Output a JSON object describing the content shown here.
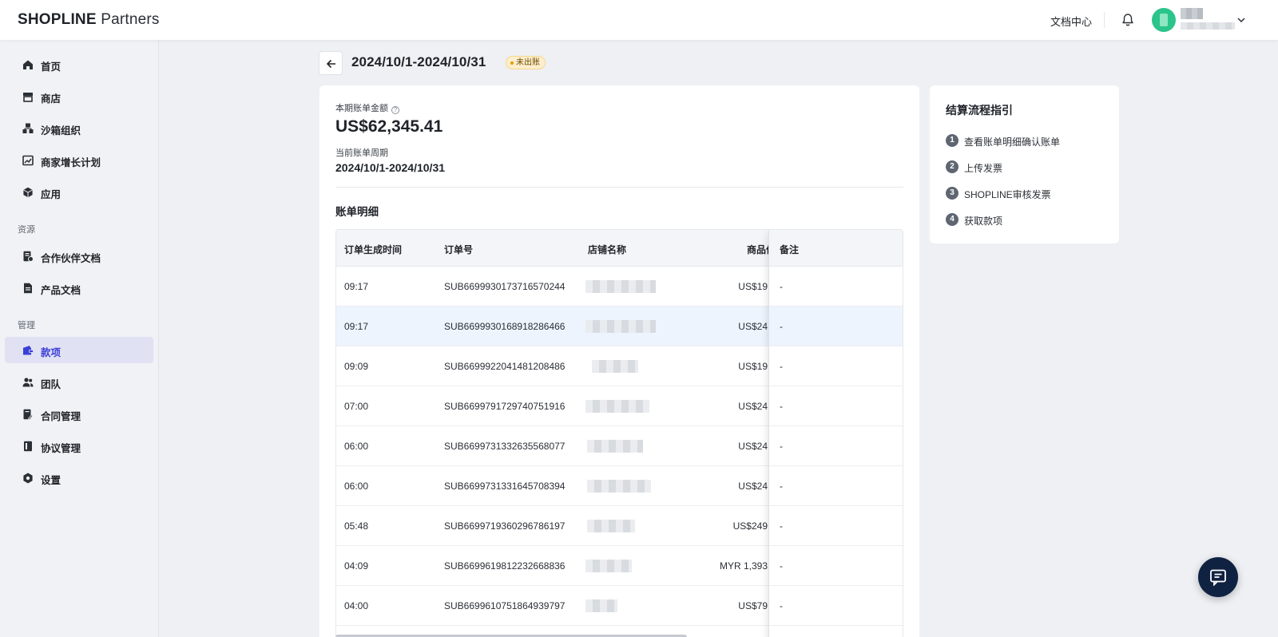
{
  "brand": {
    "logo_bold": "SHOPLINE",
    "logo_rest": "Partners"
  },
  "header": {
    "docs_link": "文档中心"
  },
  "sidebar": {
    "items_main": [
      {
        "label": "首页",
        "icon": "home-icon"
      },
      {
        "label": "商店",
        "icon": "store-icon"
      },
      {
        "label": "沙箱组织",
        "icon": "sandbox-icon"
      },
      {
        "label": "商家增长计划",
        "icon": "growth-chart-icon"
      },
      {
        "label": "应用",
        "icon": "app-cube-icon"
      }
    ],
    "section_resources": "资源",
    "items_resources": [
      {
        "label": "合作伙伴文档",
        "icon": "partner-doc-icon"
      },
      {
        "label": "产品文档",
        "icon": "product-doc-icon"
      }
    ],
    "section_manage": "管理",
    "items_manage": [
      {
        "label": "款项",
        "icon": "wallet-icon",
        "active": true
      },
      {
        "label": "团队",
        "icon": "team-icon"
      },
      {
        "label": "合同管理",
        "icon": "contract-icon"
      },
      {
        "label": "协议管理",
        "icon": "agreement-icon"
      },
      {
        "label": "设置",
        "icon": "settings-icon"
      }
    ]
  },
  "bill": {
    "title": "2024/10/1-2024/10/31",
    "status": "未出账",
    "amount_label": "本期账单金额",
    "amount": "US$62,345.41",
    "period_label": "当前账单周期",
    "period_value": "2024/10/1-2024/10/31",
    "detail_title": "账单明细"
  },
  "table": {
    "columns": [
      "订单生成时间",
      "订单号",
      "店铺名称",
      "商品价",
      "备注"
    ],
    "rows": [
      {
        "time": "09:17",
        "order": "SUB6699930173716570244",
        "price": "US$19",
        "note": "-"
      },
      {
        "time": "09:17",
        "order": "SUB6699930168918286466",
        "price": "US$24",
        "note": "-"
      },
      {
        "time": "09:09",
        "order": "SUB6699922041481208486",
        "price": "US$19",
        "note": "-"
      },
      {
        "time": "07:00",
        "order": "SUB6699791729740751916",
        "price": "US$24",
        "note": "-"
      },
      {
        "time": "06:00",
        "order": "SUB6699731332635568077",
        "price": "US$24",
        "note": "-"
      },
      {
        "time": "06:00",
        "order": "SUB6699731331645708394",
        "price": "US$24",
        "note": "-"
      },
      {
        "time": "05:48",
        "order": "SUB6699719360296786197",
        "price": "US$249",
        "note": "-"
      },
      {
        "time": "04:09",
        "order": "SUB6699619812232668836",
        "price": "MYR 1,393",
        "note": "-"
      },
      {
        "time": "04:00",
        "order": "SUB6699610751864939797",
        "price": "US$79",
        "note": "-"
      }
    ]
  },
  "guide": {
    "title": "结算流程指引",
    "steps": [
      {
        "num": "1",
        "text": "查看账单明细确认账单"
      },
      {
        "num": "2",
        "text": "上传发票"
      },
      {
        "num": "3",
        "text": "SHOPLINE审核发票"
      },
      {
        "num": "4",
        "text": "获取款项"
      }
    ]
  },
  "colors": {
    "accent": "#3b3fd6",
    "active_bg": "#e1e1f4",
    "badge_bg": "#fdeecd",
    "chat_fab": "#102241"
  }
}
